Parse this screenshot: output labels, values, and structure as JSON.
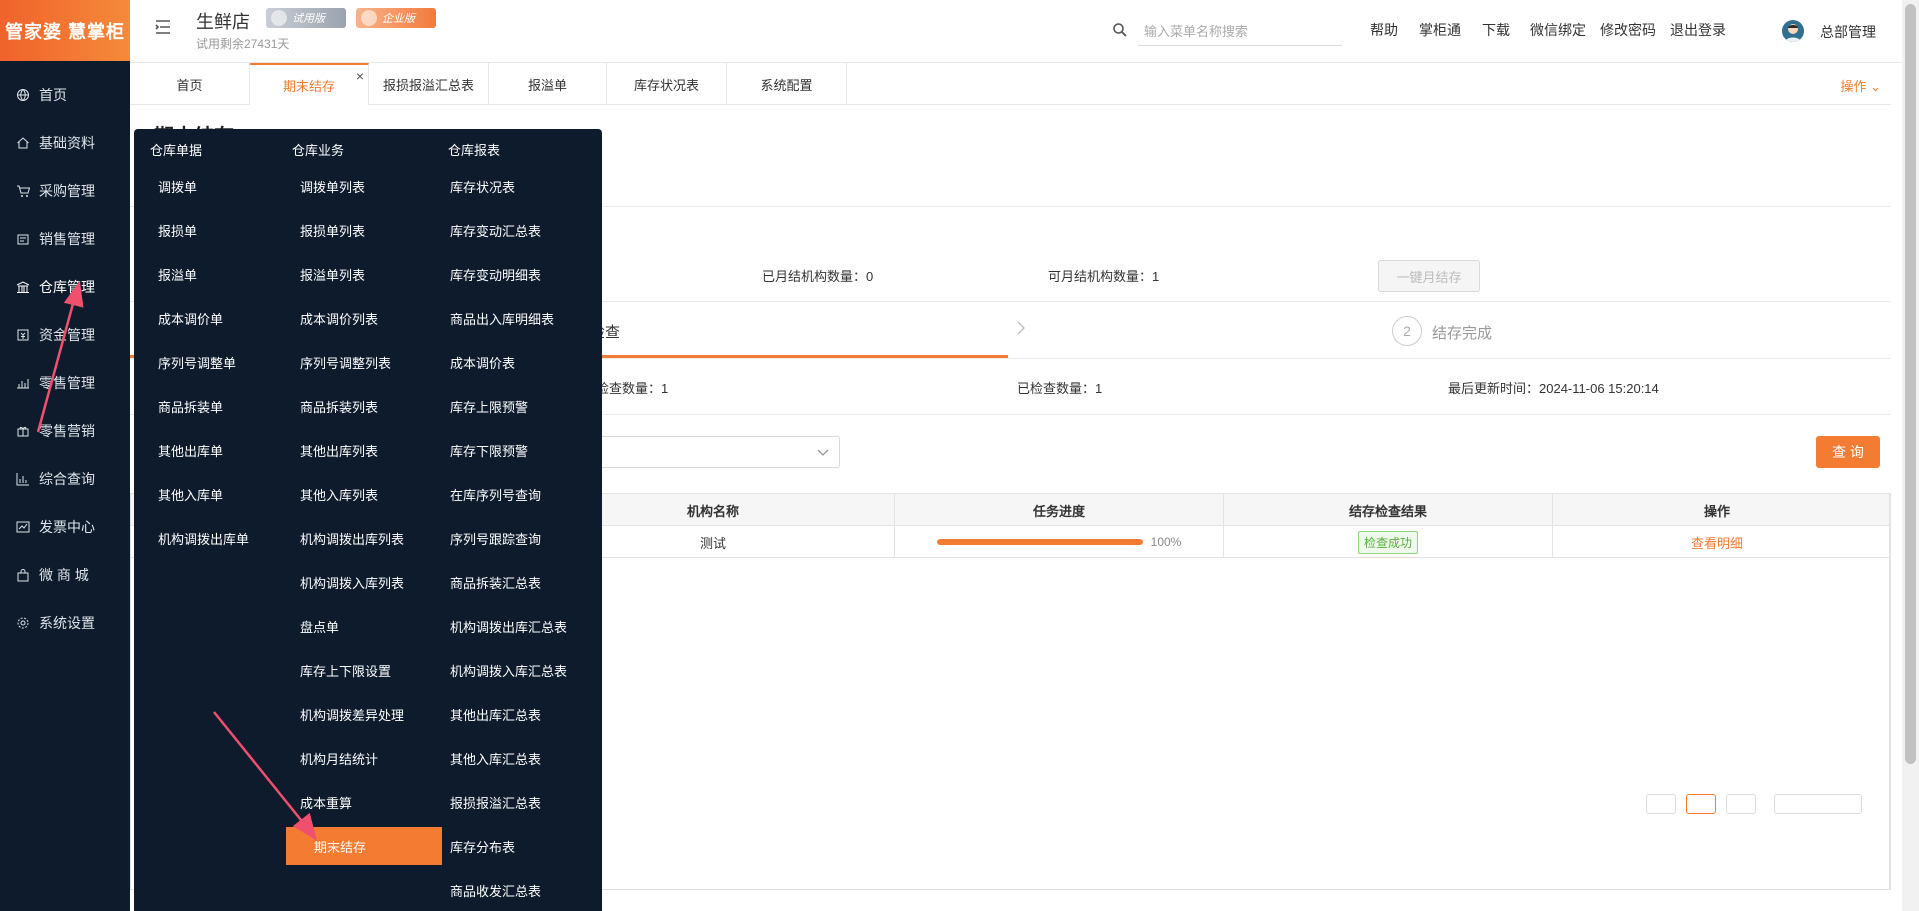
{
  "brand": {
    "logo_text": "管家婆 慧掌柜",
    "accent": "#f37b32",
    "sidebar_bg": "#0d1b2c"
  },
  "sidebar": {
    "items": [
      {
        "label": "首页",
        "icon": "globe-icon"
      },
      {
        "label": "基础资料",
        "icon": "home-icon"
      },
      {
        "label": "采购管理",
        "icon": "cart-icon"
      },
      {
        "label": "销售管理",
        "icon": "sales-icon"
      },
      {
        "label": "仓库管理",
        "icon": "warehouse-icon"
      },
      {
        "label": "资金管理",
        "icon": "money-icon"
      },
      {
        "label": "零售管理",
        "icon": "chart-icon"
      },
      {
        "label": "零售营销",
        "icon": "gift-icon"
      },
      {
        "label": "综合查询",
        "icon": "bar-chart-icon"
      },
      {
        "label": "发票中心",
        "icon": "line-chart-icon"
      },
      {
        "label": "微 商 城",
        "icon": "bag-icon"
      },
      {
        "label": "系统设置",
        "icon": "gear-icon"
      }
    ],
    "active_index": 4
  },
  "header": {
    "store_name": "生鲜店",
    "badge_trial": "试用版",
    "badge_enterprise": "企业版",
    "trial_remaining": "试用剩余27431天",
    "search_placeholder": "输入菜单名称搜索",
    "links": [
      "帮助",
      "掌柜通",
      "下载",
      "微信绑定",
      "修改密码",
      "退出登录"
    ],
    "username": "总部管理"
  },
  "tabs": {
    "items": [
      {
        "label": "首页"
      },
      {
        "label": "期末结存"
      },
      {
        "label": "报损报溢汇总表"
      },
      {
        "label": "报溢单"
      },
      {
        "label": "库存状况表"
      },
      {
        "label": "系统配置"
      }
    ],
    "active_index": 1,
    "close_glyph": "×",
    "ops_label": "操作"
  },
  "main": {
    "page_title": "期末结存",
    "stats": {
      "closed_label": "已月结机构数量：",
      "closed_value": "0",
      "available_label": "可月结机构数量：",
      "available_value": "1",
      "oneclick_button": "一键月结存"
    },
    "steps": {
      "step1_label": "检查",
      "step2_num": "2",
      "step2_label": "结存完成"
    },
    "check_stats": {
      "to_check": "检查数量：",
      "to_check_value": "1",
      "checked_label": "已检查数量：",
      "checked_value": "1",
      "updated_label": "最后更新时间：",
      "updated_value": "2024-11-06 15:20:14"
    },
    "query_button": "查 询",
    "table": {
      "columns": [
        "机构名称",
        "任务进度",
        "结存检查结果",
        "操作"
      ],
      "rows": [
        {
          "name": "测试",
          "progress": 1.0,
          "progress_text": "100%",
          "result": "检查成功",
          "action": "查看明细"
        }
      ]
    }
  },
  "mega_menu": {
    "columns": [
      {
        "title": "仓库单据",
        "items": [
          "调拨单",
          "报损单",
          "报溢单",
          "成本调价单",
          "序列号调整单",
          "商品拆装单",
          "其他出库单",
          "其他入库单",
          "机构调拨出库单"
        ]
      },
      {
        "title": "仓库业务",
        "items": [
          "调拨单列表",
          "报损单列表",
          "报溢单列表",
          "成本调价列表",
          "序列号调整列表",
          "商品拆装列表",
          "其他出库列表",
          "其他入库列表",
          "机构调拨出库列表",
          "机构调拨入库列表",
          "盘点单",
          "库存上下限设置",
          "机构调拨差异处理",
          "机构月结统计",
          "成本重算",
          "期末结存"
        ]
      },
      {
        "title": "仓库报表",
        "items": [
          "库存状况表",
          "库存变动汇总表",
          "库存变动明细表",
          "商品出入库明细表",
          "成本调价表",
          "库存上限预警",
          "库存下限预警",
          "在库序列号查询",
          "序列号跟踪查询",
          "商品拆装汇总表",
          "机构调拨出库汇总表",
          "机构调拨入库汇总表",
          "其他出库汇总表",
          "其他入库汇总表",
          "报损报溢汇总表",
          "库存分布表",
          "商品收发汇总表"
        ]
      }
    ],
    "selected_item": "期末结存"
  }
}
